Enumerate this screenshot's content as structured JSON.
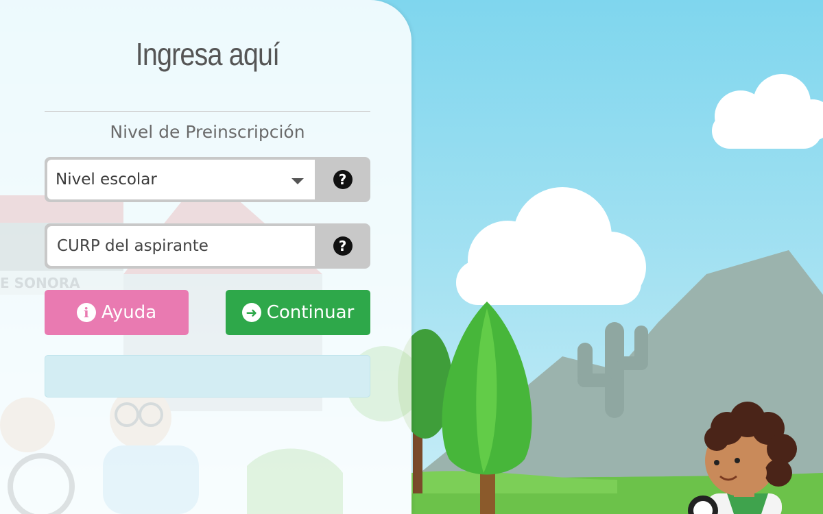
{
  "login": {
    "title": "Ingresa aquí",
    "subtitle": "Nivel de Preinscripción",
    "level_select": {
      "selected": "Nivel escolar"
    },
    "curp_field": {
      "placeholder": "CURP del aspirante",
      "value": ""
    },
    "help_button_label": "Ayuda",
    "continue_button_label": "Continuar",
    "message": ""
  },
  "background": {
    "faded_sign_text": "E SONORA"
  },
  "colors": {
    "help_button": "#e97ab1",
    "continue_button": "#2ea84a",
    "alert_bg": "#d3edf3",
    "sky": "#7fd6ee",
    "grass": "#6cc24a"
  },
  "icons": {
    "field_help": "question-circle-icon",
    "help": "info-circle-icon",
    "continue": "arrow-circle-right-icon",
    "dropdown": "chevron-down-icon"
  }
}
